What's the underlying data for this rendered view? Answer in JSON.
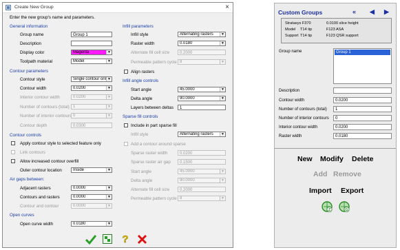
{
  "dialog": {
    "title": "Create New Group",
    "intro": "Enter the new group's name and parameters.",
    "sections": {
      "general": "General information",
      "contour_params": "Contour parameters",
      "contour_controls": "Contour controls",
      "air_gaps": "Air gaps between:",
      "open_curves": "Open curves",
      "infill_params": "Infill parameters",
      "infill_angle": "Infill angle controls",
      "sparse_fill": "Sparse fill controls"
    },
    "fields": {
      "group_name": {
        "label": "Group name",
        "value": "Group 1"
      },
      "description": {
        "label": "Description",
        "value": ""
      },
      "display_color": {
        "label": "Display color",
        "value": "Magenta"
      },
      "toolpath_material": {
        "label": "Toolpath material",
        "value": "Model"
      },
      "contour_style": {
        "label": "Contour style",
        "value": "Single contour only"
      },
      "contour_width": {
        "label": "Contour width",
        "value": "0.0200"
      },
      "interior_contour_width": {
        "label": "Interior contour width",
        "value": "0.0200"
      },
      "number_contours_total": {
        "label": "Number of contours (total)",
        "value": "1"
      },
      "number_interior_contours": {
        "label": "Number of interior contours",
        "value": "0"
      },
      "contour_depth": {
        "label": "Contour depth",
        "value": "0.0300"
      },
      "apply_contour_style": {
        "label": "Apply contour style to selected feature only"
      },
      "link_contours": {
        "label": "Link contours"
      },
      "allow_overfill": {
        "label": "Allow increased contour overfill"
      },
      "outer_contour_location": {
        "label": "Outer contour location",
        "value": "Inside"
      },
      "adjacent_rasters": {
        "label": "Adjacent rasters",
        "value": "0.0000"
      },
      "contours_and_rasters": {
        "label": "Contours and rasters",
        "value": "0.0000"
      },
      "contour_and_contour": {
        "label": "Contour and contour",
        "value": "0.0000"
      },
      "open_curve_width": {
        "label": "Open curve width",
        "value": "0.0180"
      },
      "infill_style": {
        "label": "Infill style",
        "value": "Alternating rasters"
      },
      "raster_width": {
        "label": "Raster width",
        "value": "0.0180"
      },
      "alternate_fill_cell_size": {
        "label": "Alternate fill cell size",
        "value": "0.2000"
      },
      "permeable_pattern_cycle": {
        "label": "Permeable pattern cycle",
        "value": "8"
      },
      "align_rasters": {
        "label": "Align rasters"
      },
      "start_angle": {
        "label": "Start angle",
        "value": "45.0000"
      },
      "delta_angle": {
        "label": "Delta angle",
        "value": "90.0000"
      },
      "layers_between_deltas": {
        "label": "Layers between deltas",
        "value": "1"
      },
      "include_sparse": {
        "label": "Include in part sparse fill"
      },
      "sparse_infill_style": {
        "label": "Infill style",
        "value": "Alternating rasters"
      },
      "add_contour_sparse": {
        "label": "Add a contour around sparse"
      },
      "sparse_raster_width": {
        "label": "Sparse raster width",
        "value": "0.0200"
      },
      "sparse_raster_air_gap": {
        "label": "Sparse raster air gap",
        "value": "0.1500"
      },
      "sparse_start_angle": {
        "label": "Start angle",
        "value": "45.0000"
      },
      "sparse_delta_angle": {
        "label": "Delta angle",
        "value": "90.0000"
      },
      "sparse_alt_fill_cell": {
        "label": "Alternate fill cell size",
        "value": "0.2000"
      },
      "sparse_permeable_cycle": {
        "label": "Permeable pattern cycle",
        "value": "8"
      }
    },
    "colors": {
      "magenta": "#ff1aff",
      "ok": "#2aa02a",
      "cancel": "#e01010",
      "help": "#d6b800",
      "section": "#1a3ea8"
    },
    "icons": [
      "check-icon",
      "preview-icon",
      "help-icon",
      "cancel-icon"
    ]
  },
  "panel": {
    "title": "Custom Groups",
    "info": {
      "line1_left": "Stratasys F370",
      "line1_right": "0.0100 slice height",
      "line2_left": "Model",
      "line2_mid": "T14 tip",
      "line2_right": "F123 ASA",
      "line3_left": "Support",
      "line3_mid": "T14 tip",
      "line3_right": "F123 QSR support"
    },
    "group_name_label": "Group name",
    "groups": [
      "Group 1"
    ],
    "props": [
      {
        "label": "Description",
        "value": ""
      },
      {
        "label": "Contour width",
        "value": "0.0200"
      },
      {
        "label": "Number of contours (total)",
        "value": "1"
      },
      {
        "label": "Number of interior contours",
        "value": "0"
      },
      {
        "label": "Interior contour width",
        "value": "0.0200"
      },
      {
        "label": "Raster width",
        "value": "0.0180"
      }
    ],
    "buttons": {
      "new": "New",
      "modify": "Modify",
      "delete": "Delete",
      "add": "Add",
      "remove": "Remove",
      "import": "Import",
      "export": "Export"
    }
  }
}
